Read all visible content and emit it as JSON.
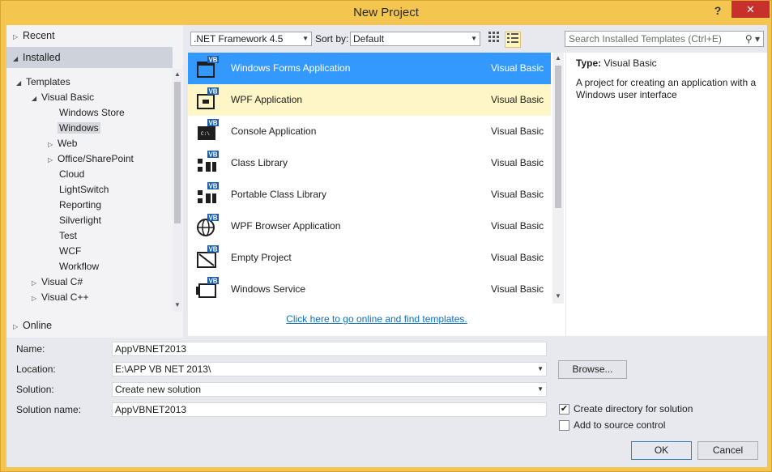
{
  "window": {
    "title": "New Project",
    "help": "?",
    "close": "✕"
  },
  "tree": {
    "recent": "Recent",
    "installed": "Installed",
    "templates": "Templates",
    "visual_basic": "Visual Basic",
    "vb_children": [
      "Windows Store",
      "Windows",
      "Web",
      "Office/SharePoint",
      "Cloud",
      "LightSwitch",
      "Reporting",
      "Silverlight",
      "Test",
      "WCF",
      "Workflow"
    ],
    "visual_csharp": "Visual C#",
    "visual_cpp": "Visual C++",
    "online": "Online"
  },
  "toolbar": {
    "framework": ".NET Framework 4.5",
    "sort_label": "Sort by:",
    "sort_value": "Default",
    "search_placeholder": "Search Installed Templates (Ctrl+E)"
  },
  "templates": [
    {
      "name": "Windows Forms Application",
      "lang": "Visual Basic",
      "icon": "winforms-icon"
    },
    {
      "name": "WPF Application",
      "lang": "Visual Basic",
      "icon": "wpf-icon"
    },
    {
      "name": "Console Application",
      "lang": "Visual Basic",
      "icon": "console-icon"
    },
    {
      "name": "Class Library",
      "lang": "Visual Basic",
      "icon": "class-library-icon"
    },
    {
      "name": "Portable Class Library",
      "lang": "Visual Basic",
      "icon": "portable-library-icon"
    },
    {
      "name": "WPF Browser Application",
      "lang": "Visual Basic",
      "icon": "globe-icon"
    },
    {
      "name": "Empty Project",
      "lang": "Visual Basic",
      "icon": "empty-project-icon"
    },
    {
      "name": "Windows Service",
      "lang": "Visual Basic",
      "icon": "service-icon"
    }
  ],
  "vb_badge": "VB",
  "console_glyph": "C:\\",
  "online_link": "Click here to go online and find templates.",
  "description": {
    "type_label": "Type:",
    "type_value": "Visual Basic",
    "text": "A project for creating an application with a Windows user interface"
  },
  "form": {
    "name_label": "Name:",
    "name_value": "AppVBNET2013",
    "location_label": "Location:",
    "location_value": "E:\\APP VB NET 2013\\",
    "solution_label": "Solution:",
    "solution_value": "Create new solution",
    "solution_name_label": "Solution name:",
    "solution_name_value": "AppVBNET2013",
    "browse": "Browse...",
    "create_dir": "Create directory for solution",
    "add_source": "Add to source control",
    "ok": "OK",
    "cancel": "Cancel"
  },
  "colors": {
    "accent": "#3399ff",
    "title_bar": "#f4c64f",
    "hover_row": "#fff6c7",
    "link": "#0e70c0"
  }
}
